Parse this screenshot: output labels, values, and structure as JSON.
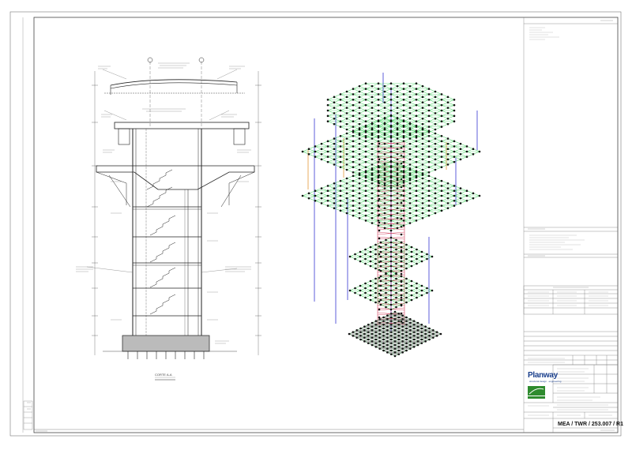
{
  "titleblock": {
    "drawing_number": "MEA / TWR / 253.007 / R1",
    "company": "Planway",
    "company_tagline": "structural design · engineering"
  },
  "section": {
    "caption": "CORTE A-A"
  },
  "colors": {
    "frame": "#555555",
    "ink": "#222222",
    "slab_green": "#22cc44",
    "column_blue": "#1a1acc",
    "core_red": "#cc2244",
    "node_black": "#111111",
    "brace_orange": "#e08a1e",
    "logo_blue": "#1a3f8c",
    "logo_green": "#2e8b2e"
  }
}
